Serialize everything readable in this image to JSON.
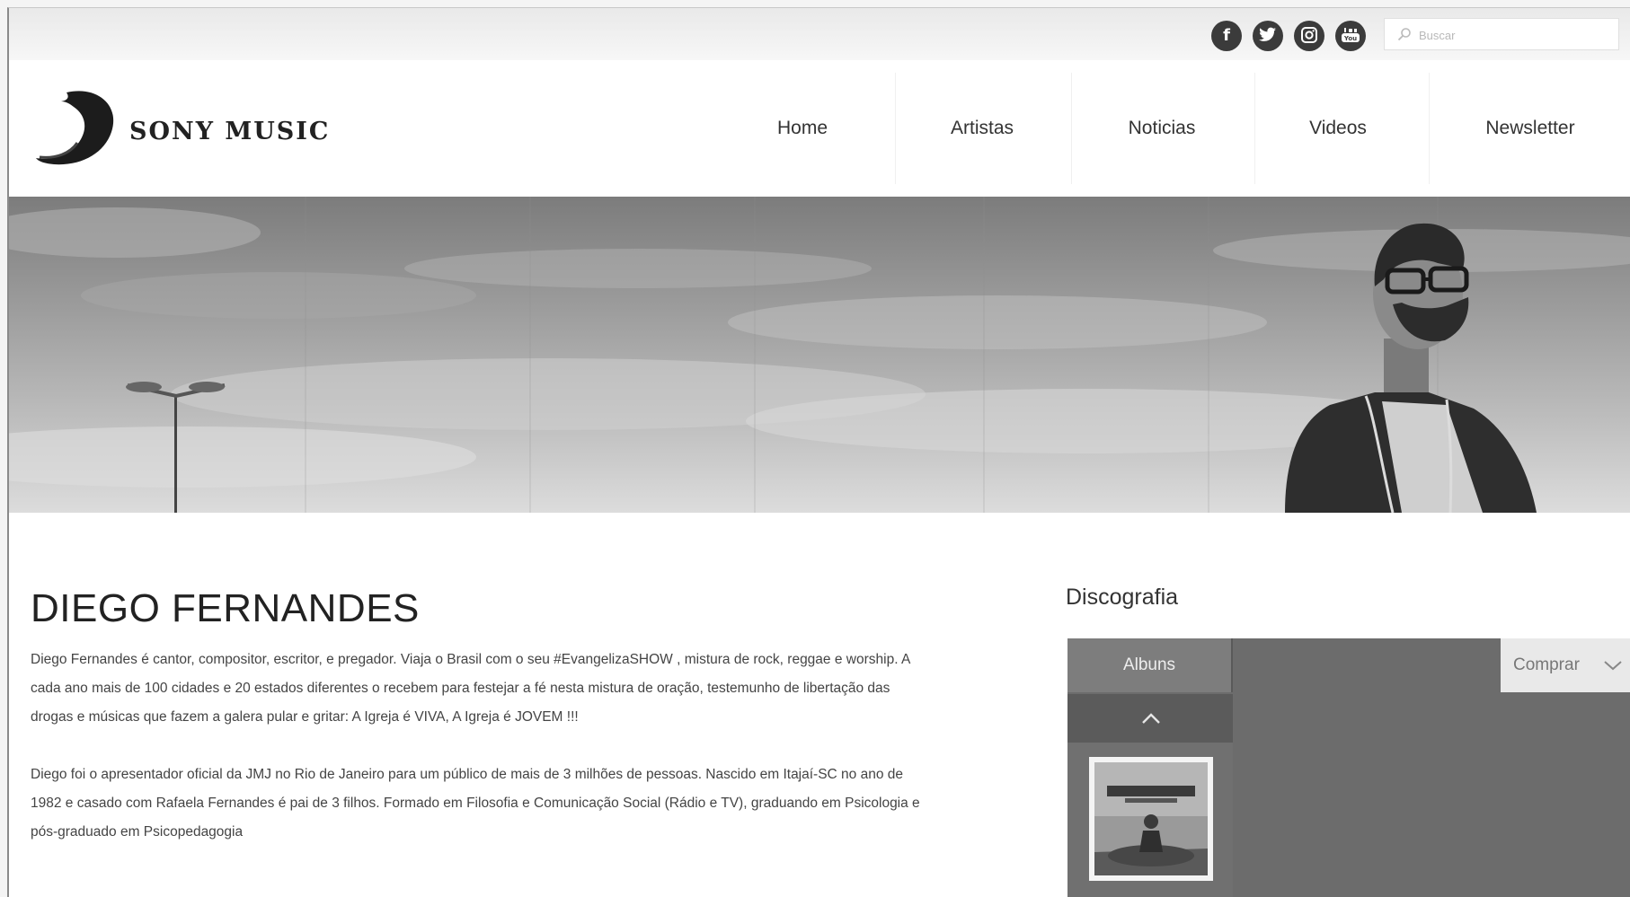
{
  "topbar": {
    "social_icons": [
      "facebook-icon",
      "twitter-icon",
      "instagram-icon",
      "youtube-icon"
    ],
    "social_labels": {
      "facebook": "f",
      "youtube": "You"
    },
    "search": {
      "placeholder": "Buscar"
    }
  },
  "header": {
    "logo_text": "SONY MUSIC",
    "nav": [
      {
        "label": "Home"
      },
      {
        "label": "Artistas"
      },
      {
        "label": "Noticias"
      },
      {
        "label": "Videos"
      },
      {
        "label": "Newsletter"
      }
    ]
  },
  "artist": {
    "name": "DIEGO FERNANDES",
    "bio": [
      "Diego Fernandes é cantor, compositor, escritor, e pregador. Viaja o Brasil com o seu #EvangelizaSHOW , mistura de rock, reggae e worship. A cada ano mais de 100 cidades e 20 estados diferentes o recebem para festejar a fé nesta mistura de oração, testemunho de libertação das drogas e músicas que fazem a galera pular e gritar: A Igreja é VIVA, A Igreja é JOVEM !!!",
      "Diego foi o apresentador oficial da JMJ no Rio de Janeiro para um público de mais de 3 milhões de pessoas. Nascido em Itajaí-SC no ano de 1982 e casado com Rafaela Fernandes é pai de 3 filhos. Formado em Filosofia e Comunicação Social (Rádio e TV), graduando em Psicologia e pós-graduado em Psicopedagogia"
    ]
  },
  "discography": {
    "title": "Discografia",
    "tab_label": "Albuns",
    "buy_label": "Comprar"
  }
}
